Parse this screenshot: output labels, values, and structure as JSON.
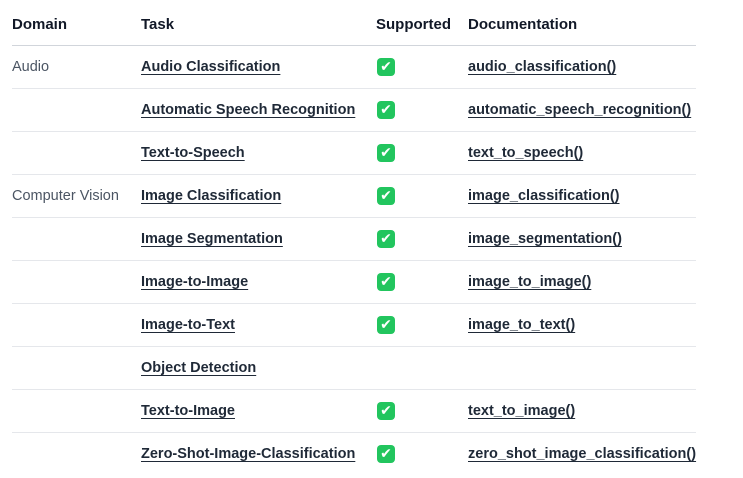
{
  "headers": {
    "domain": "Domain",
    "task": "Task",
    "supported": "Supported",
    "documentation": "Documentation"
  },
  "check_glyph": "✔",
  "check_color": "#22c55e",
  "rows": [
    {
      "domain": "Audio",
      "task": "Audio Classification",
      "supported": true,
      "doc": "audio_classification()"
    },
    {
      "domain": "",
      "task": "Automatic Speech Recognition",
      "supported": true,
      "doc": "automatic_speech_recognition()"
    },
    {
      "domain": "",
      "task": "Text-to-Speech",
      "supported": true,
      "doc": "text_to_speech()"
    },
    {
      "domain": "Computer Vision",
      "task": "Image Classification",
      "supported": true,
      "doc": "image_classification()"
    },
    {
      "domain": "",
      "task": "Image Segmentation",
      "supported": true,
      "doc": "image_segmentation()"
    },
    {
      "domain": "",
      "task": "Image-to-Image",
      "supported": true,
      "doc": "image_to_image()"
    },
    {
      "domain": "",
      "task": "Image-to-Text",
      "supported": true,
      "doc": "image_to_text()"
    },
    {
      "domain": "",
      "task": "Object Detection",
      "supported": false,
      "doc": ""
    },
    {
      "domain": "",
      "task": "Text-to-Image",
      "supported": true,
      "doc": "text_to_image()"
    },
    {
      "domain": "",
      "task": "Zero-Shot-Image-Classification",
      "supported": true,
      "doc": "zero_shot_image_classification()"
    }
  ]
}
